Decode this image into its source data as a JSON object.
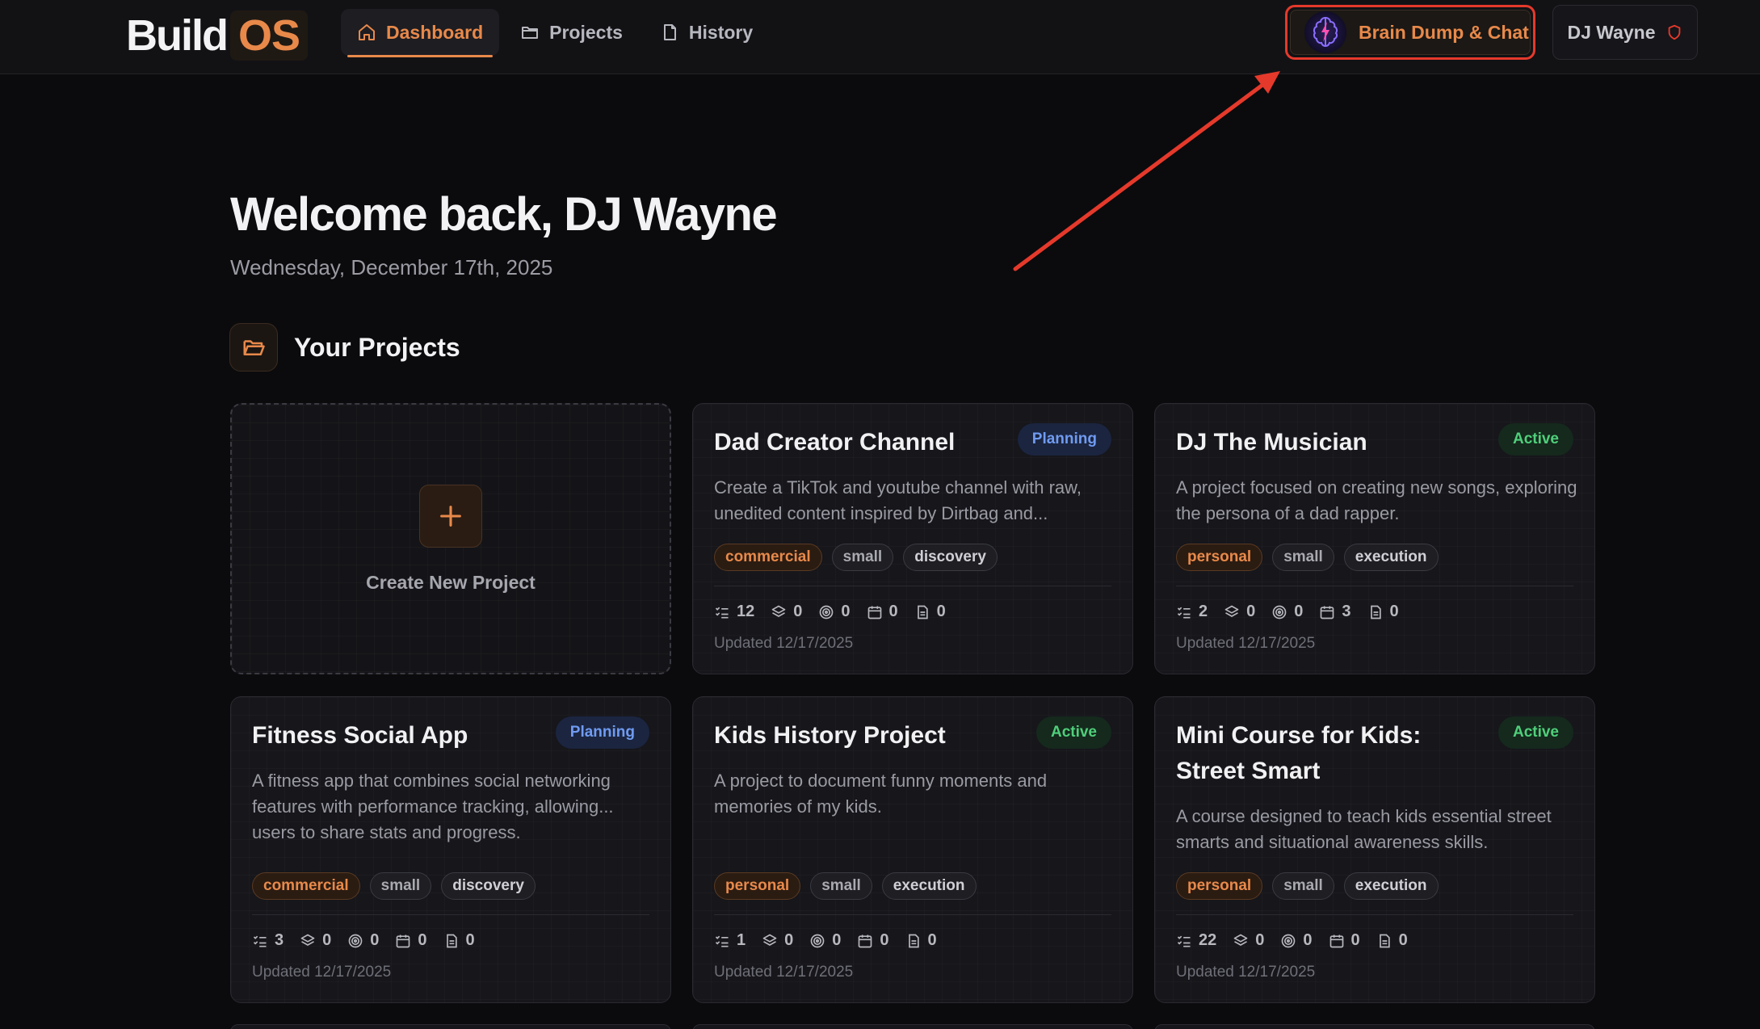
{
  "header": {
    "logo_build": "Build",
    "logo_os": "OS",
    "nav": [
      {
        "label": "Dashboard",
        "icon": "home-icon",
        "active": true
      },
      {
        "label": "Projects",
        "icon": "folder-icon",
        "active": false
      },
      {
        "label": "History",
        "icon": "document-icon",
        "active": false
      }
    ],
    "brain_dump_label": "Brain Dump & Chat",
    "brain_icon": "brain-icon",
    "user_label": "DJ Wayne",
    "user_icon": "shield-icon"
  },
  "annotation": {
    "type": "arrow",
    "color": "#e5392b"
  },
  "welcome": {
    "title": "Welcome back, DJ Wayne",
    "date": "Wednesday, December 17th, 2025"
  },
  "projects_section": {
    "title": "Your Projects",
    "icon": "folder-open-icon",
    "create_label": "Create New Project"
  },
  "projects": [
    {
      "title": "Dad Creator Channel",
      "status": "Planning",
      "description": "Create a TikTok and youtube channel with raw, unedited content inspired by Dirtbag and...",
      "tags": [
        "commercial",
        "small",
        "discovery"
      ],
      "stats": {
        "tasks": "12",
        "phases": "0",
        "goals": "0",
        "events": "0",
        "docs": "0"
      },
      "updated": "Updated 12/17/2025"
    },
    {
      "title": "DJ The Musician",
      "status": "Active",
      "description": "A project focused on creating new songs, exploring the persona of a dad rapper.",
      "tags": [
        "personal",
        "small",
        "execution"
      ],
      "stats": {
        "tasks": "2",
        "phases": "0",
        "goals": "0",
        "events": "3",
        "docs": "0"
      },
      "updated": "Updated 12/17/2025"
    },
    {
      "title": "Fitness Social App",
      "status": "Planning",
      "description": "A fitness app that combines social networking features with performance tracking, allowing... users to share stats and progress.",
      "tags": [
        "commercial",
        "small",
        "discovery"
      ],
      "stats": {
        "tasks": "3",
        "phases": "0",
        "goals": "0",
        "events": "0",
        "docs": "0"
      },
      "updated": "Updated 12/17/2025"
    },
    {
      "title": "Kids History Project",
      "status": "Active",
      "description": "A project to document funny moments and memories of my kids.",
      "tags": [
        "personal",
        "small",
        "execution"
      ],
      "stats": {
        "tasks": "1",
        "phases": "0",
        "goals": "0",
        "events": "0",
        "docs": "0"
      },
      "updated": "Updated 12/17/2025"
    },
    {
      "title": "Mini Course for Kids: Street Smart",
      "status": "Active",
      "description": "A course designed to teach kids essential street smarts and situational awareness skills.",
      "tags": [
        "personal",
        "small",
        "execution"
      ],
      "stats": {
        "tasks": "22",
        "phases": "0",
        "goals": "0",
        "events": "0",
        "docs": "0"
      },
      "updated": "Updated 12/17/2025"
    }
  ],
  "colors": {
    "accent": "#e8894a",
    "planning": "#6f9bf2",
    "active": "#4fcf7a",
    "annotation": "#e5392b"
  }
}
